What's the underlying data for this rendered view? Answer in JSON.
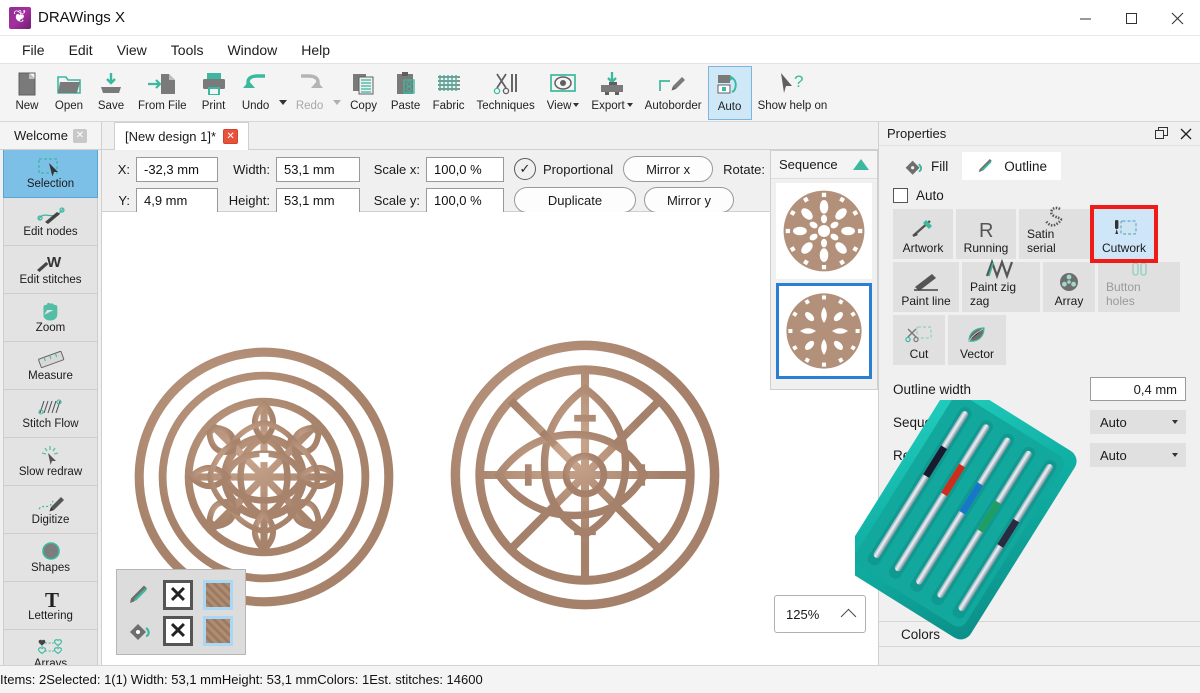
{
  "window": {
    "title": "DRAWings X",
    "logo_icon": "drawings-logo-icon",
    "minimize_icon": "minimize-icon",
    "maximize_icon": "maximize-icon",
    "close_icon": "close-icon"
  },
  "menu": {
    "items": [
      "File",
      "Edit",
      "View",
      "Tools",
      "Window",
      "Help"
    ]
  },
  "toolbar": {
    "buttons": [
      {
        "label": "New",
        "icon": "new-document-icon",
        "state": "enabled"
      },
      {
        "label": "Open",
        "icon": "open-folder-icon",
        "state": "enabled"
      },
      {
        "label": "Save",
        "icon": "save-disk-icon",
        "state": "enabled"
      },
      {
        "label": "From File",
        "icon": "import-from-file-icon",
        "state": "enabled"
      },
      {
        "label": "Print",
        "icon": "printer-icon",
        "state": "enabled"
      },
      {
        "label": "Undo",
        "icon": "undo-arrow-icon",
        "state": "enabled",
        "has_caret": true
      },
      {
        "label": "Redo",
        "icon": "redo-arrow-icon",
        "state": "disabled",
        "has_caret": true
      },
      {
        "label": "Copy",
        "icon": "copy-icon",
        "state": "enabled"
      },
      {
        "label": "Paste",
        "icon": "paste-clipboard-icon",
        "state": "enabled"
      },
      {
        "label": "Fabric",
        "icon": "fabric-weave-icon",
        "state": "enabled"
      },
      {
        "label": "Techniques",
        "icon": "techniques-scissors-needle-icon",
        "state": "enabled"
      },
      {
        "label": "View",
        "icon": "view-eye-icon",
        "state": "enabled",
        "dropdown": true
      },
      {
        "label": "Export",
        "icon": "export-machine-icon",
        "state": "enabled",
        "dropdown": true
      },
      {
        "label": "Autoborder",
        "icon": "autoborder-pen-icon",
        "state": "enabled"
      },
      {
        "label": "Auto",
        "icon": "auto-arrange-icon",
        "state": "active"
      },
      {
        "label": "Show help on",
        "icon": "help-cursor-icon",
        "state": "enabled"
      }
    ]
  },
  "toolbox": {
    "welcome_tab": "Welcome",
    "welcome_close_icon": "close-tab-icon",
    "items": [
      {
        "label": "Selection",
        "icon": "selection-arrow-icon",
        "selected": true
      },
      {
        "label": "Edit nodes",
        "icon": "edit-nodes-icon",
        "selected": false
      },
      {
        "label": "Edit stitches",
        "icon": "edit-stitches-icon",
        "selected": false
      },
      {
        "label": "Zoom",
        "icon": "pan-hand-icon",
        "selected": false
      },
      {
        "label": "Measure",
        "icon": "measure-ruler-icon",
        "selected": false
      },
      {
        "label": "Stitch Flow",
        "icon": "stitch-flow-icon",
        "selected": false
      },
      {
        "label": "Slow redraw",
        "icon": "slow-redraw-icon",
        "selected": false
      },
      {
        "label": "Digitize",
        "icon": "digitize-pen-icon",
        "selected": false
      },
      {
        "label": "Shapes",
        "icon": "shapes-circle-icon",
        "selected": false
      },
      {
        "label": "Lettering",
        "icon": "lettering-t-icon",
        "selected": false
      },
      {
        "label": "Arrays",
        "icon": "arrays-hearts-icon",
        "selected": false
      }
    ]
  },
  "design_tab": {
    "title": "[New design 1]*",
    "close_icon": "close-design-icon"
  },
  "options_bar": {
    "x_label": "X:",
    "x_value": "-32,3 mm",
    "y_label": "Y:",
    "y_value": "4,9 mm",
    "width_label": "Width:",
    "width_value": "53,1 mm",
    "height_label": "Height:",
    "height_value": "53,1 mm",
    "scale_x_label": "Scale x:",
    "scale_x_value": "100,0 %",
    "scale_y_label": "Scale y:",
    "scale_y_value": "100,0 %",
    "proportional_label": "Proportional",
    "proportional_checked": true,
    "proportional_icon": "check-mark-icon",
    "duplicate_label": "Duplicate",
    "mirror_x_label": "Mirror x",
    "mirror_y_label": "Mirror y",
    "rotate_label": "Rotate:"
  },
  "sequence": {
    "title": "Sequence",
    "collapse_icon": "triangle-up-icon",
    "thumbs": [
      {
        "name": "sequence-thumb-1",
        "selected": false
      },
      {
        "name": "sequence-thumb-2",
        "selected": true
      }
    ]
  },
  "canvas": {
    "design_color": "#b3907a",
    "objects": [
      {
        "name": "embroidery-design-left",
        "pattern": "celtic-knot-lace-medallion"
      },
      {
        "name": "embroidery-design-right",
        "pattern": "compass-rose-lace-medallion"
      }
    ]
  },
  "color_widget": {
    "rows": [
      {
        "icon": "outline-pen-icon",
        "none_icon": "no-color-x-icon",
        "swatch": "fabric-tan-swatch"
      },
      {
        "icon": "fill-bucket-icon",
        "none_icon": "no-color-x-icon",
        "swatch": "fabric-tan-swatch"
      }
    ]
  },
  "zoom_control": {
    "value": "125%",
    "expand_icon": "chevron-up-icon"
  },
  "properties": {
    "title": "Properties",
    "undock_icon": "undock-window-icon",
    "close_icon": "close-panel-icon",
    "tabs": [
      {
        "label": "Fill",
        "icon": "fill-bucket-icon",
        "active": false
      },
      {
        "label": "Outline",
        "icon": "outline-pen-icon",
        "active": true
      }
    ],
    "auto_label": "Auto",
    "auto_checked": false,
    "stitch_types": [
      {
        "label": "Artwork",
        "icon": "artwork-brush-icon",
        "selected": false,
        "highlight": false
      },
      {
        "label": "Running",
        "icon": "running-stitch-r-icon",
        "selected": false,
        "highlight": false
      },
      {
        "label": "Satin serial",
        "icon": "satin-serial-icon",
        "selected": false,
        "highlight": false
      },
      {
        "label": "Cutwork",
        "icon": "cutwork-icon",
        "selected": true,
        "highlight": true
      },
      {
        "label": "Paint line",
        "icon": "paint-line-icon",
        "selected": false,
        "highlight": false
      },
      {
        "label": "Paint zig zag",
        "icon": "paint-zigzag-icon",
        "selected": false,
        "highlight": false
      },
      {
        "label": "Array",
        "icon": "array-icon",
        "selected": false,
        "highlight": false
      },
      {
        "label": "Button holes",
        "icon": "button-holes-icon",
        "selected": false,
        "highlight": false,
        "dim": true
      },
      {
        "label": "Cut",
        "icon": "cut-scissors-icon",
        "selected": false,
        "highlight": false
      },
      {
        "label": "Vector",
        "icon": "vector-leaf-icon",
        "selected": false,
        "highlight": false
      }
    ],
    "fields": [
      {
        "label": "Outline width",
        "value": "0,4 mm",
        "type": "input"
      },
      {
        "label": "Sequence",
        "value": "Auto",
        "type": "select"
      },
      {
        "label": "Remove",
        "value": "Auto",
        "type": "select"
      }
    ],
    "colors_label": "Colors",
    "highlight_color": "#ee1b1b",
    "accent_color": "#3cb8a0",
    "selection_color": "#cfe6f8"
  },
  "needle_photo": {
    "name": "cutwork-needles-photo",
    "case_color": "#17b8ac",
    "needle_band_colors": [
      "#1a1a2e",
      "#cc2e1c",
      "#1878c8",
      "#1f9e63",
      "#2a2a40"
    ]
  },
  "statusbar": {
    "cells": [
      "Items: 2",
      "Selected: 1",
      "(1) Width: 53,1 mm",
      "Height: 53,1 mm",
      "Colors: 1",
      "Est. stitches: 14600"
    ]
  }
}
